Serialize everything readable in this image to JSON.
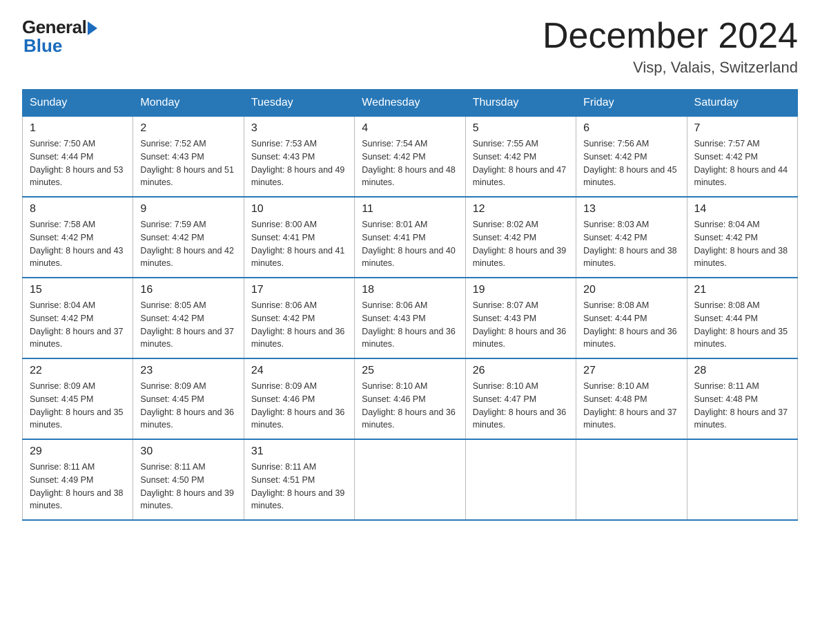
{
  "header": {
    "logo_general": "General",
    "logo_blue": "Blue",
    "title": "December 2024",
    "location": "Visp, Valais, Switzerland"
  },
  "days_of_week": [
    "Sunday",
    "Monday",
    "Tuesday",
    "Wednesday",
    "Thursday",
    "Friday",
    "Saturday"
  ],
  "weeks": [
    [
      {
        "day": "1",
        "sunrise": "7:50 AM",
        "sunset": "4:44 PM",
        "daylight": "8 hours and 53 minutes."
      },
      {
        "day": "2",
        "sunrise": "7:52 AM",
        "sunset": "4:43 PM",
        "daylight": "8 hours and 51 minutes."
      },
      {
        "day": "3",
        "sunrise": "7:53 AM",
        "sunset": "4:43 PM",
        "daylight": "8 hours and 49 minutes."
      },
      {
        "day": "4",
        "sunrise": "7:54 AM",
        "sunset": "4:42 PM",
        "daylight": "8 hours and 48 minutes."
      },
      {
        "day": "5",
        "sunrise": "7:55 AM",
        "sunset": "4:42 PM",
        "daylight": "8 hours and 47 minutes."
      },
      {
        "day": "6",
        "sunrise": "7:56 AM",
        "sunset": "4:42 PM",
        "daylight": "8 hours and 45 minutes."
      },
      {
        "day": "7",
        "sunrise": "7:57 AM",
        "sunset": "4:42 PM",
        "daylight": "8 hours and 44 minutes."
      }
    ],
    [
      {
        "day": "8",
        "sunrise": "7:58 AM",
        "sunset": "4:42 PM",
        "daylight": "8 hours and 43 minutes."
      },
      {
        "day": "9",
        "sunrise": "7:59 AM",
        "sunset": "4:42 PM",
        "daylight": "8 hours and 42 minutes."
      },
      {
        "day": "10",
        "sunrise": "8:00 AM",
        "sunset": "4:41 PM",
        "daylight": "8 hours and 41 minutes."
      },
      {
        "day": "11",
        "sunrise": "8:01 AM",
        "sunset": "4:41 PM",
        "daylight": "8 hours and 40 minutes."
      },
      {
        "day": "12",
        "sunrise": "8:02 AM",
        "sunset": "4:42 PM",
        "daylight": "8 hours and 39 minutes."
      },
      {
        "day": "13",
        "sunrise": "8:03 AM",
        "sunset": "4:42 PM",
        "daylight": "8 hours and 38 minutes."
      },
      {
        "day": "14",
        "sunrise": "8:04 AM",
        "sunset": "4:42 PM",
        "daylight": "8 hours and 38 minutes."
      }
    ],
    [
      {
        "day": "15",
        "sunrise": "8:04 AM",
        "sunset": "4:42 PM",
        "daylight": "8 hours and 37 minutes."
      },
      {
        "day": "16",
        "sunrise": "8:05 AM",
        "sunset": "4:42 PM",
        "daylight": "8 hours and 37 minutes."
      },
      {
        "day": "17",
        "sunrise": "8:06 AM",
        "sunset": "4:42 PM",
        "daylight": "8 hours and 36 minutes."
      },
      {
        "day": "18",
        "sunrise": "8:06 AM",
        "sunset": "4:43 PM",
        "daylight": "8 hours and 36 minutes."
      },
      {
        "day": "19",
        "sunrise": "8:07 AM",
        "sunset": "4:43 PM",
        "daylight": "8 hours and 36 minutes."
      },
      {
        "day": "20",
        "sunrise": "8:08 AM",
        "sunset": "4:44 PM",
        "daylight": "8 hours and 36 minutes."
      },
      {
        "day": "21",
        "sunrise": "8:08 AM",
        "sunset": "4:44 PM",
        "daylight": "8 hours and 35 minutes."
      }
    ],
    [
      {
        "day": "22",
        "sunrise": "8:09 AM",
        "sunset": "4:45 PM",
        "daylight": "8 hours and 35 minutes."
      },
      {
        "day": "23",
        "sunrise": "8:09 AM",
        "sunset": "4:45 PM",
        "daylight": "8 hours and 36 minutes."
      },
      {
        "day": "24",
        "sunrise": "8:09 AM",
        "sunset": "4:46 PM",
        "daylight": "8 hours and 36 minutes."
      },
      {
        "day": "25",
        "sunrise": "8:10 AM",
        "sunset": "4:46 PM",
        "daylight": "8 hours and 36 minutes."
      },
      {
        "day": "26",
        "sunrise": "8:10 AM",
        "sunset": "4:47 PM",
        "daylight": "8 hours and 36 minutes."
      },
      {
        "day": "27",
        "sunrise": "8:10 AM",
        "sunset": "4:48 PM",
        "daylight": "8 hours and 37 minutes."
      },
      {
        "day": "28",
        "sunrise": "8:11 AM",
        "sunset": "4:48 PM",
        "daylight": "8 hours and 37 minutes."
      }
    ],
    [
      {
        "day": "29",
        "sunrise": "8:11 AM",
        "sunset": "4:49 PM",
        "daylight": "8 hours and 38 minutes."
      },
      {
        "day": "30",
        "sunrise": "8:11 AM",
        "sunset": "4:50 PM",
        "daylight": "8 hours and 39 minutes."
      },
      {
        "day": "31",
        "sunrise": "8:11 AM",
        "sunset": "4:51 PM",
        "daylight": "8 hours and 39 minutes."
      },
      null,
      null,
      null,
      null
    ]
  ]
}
